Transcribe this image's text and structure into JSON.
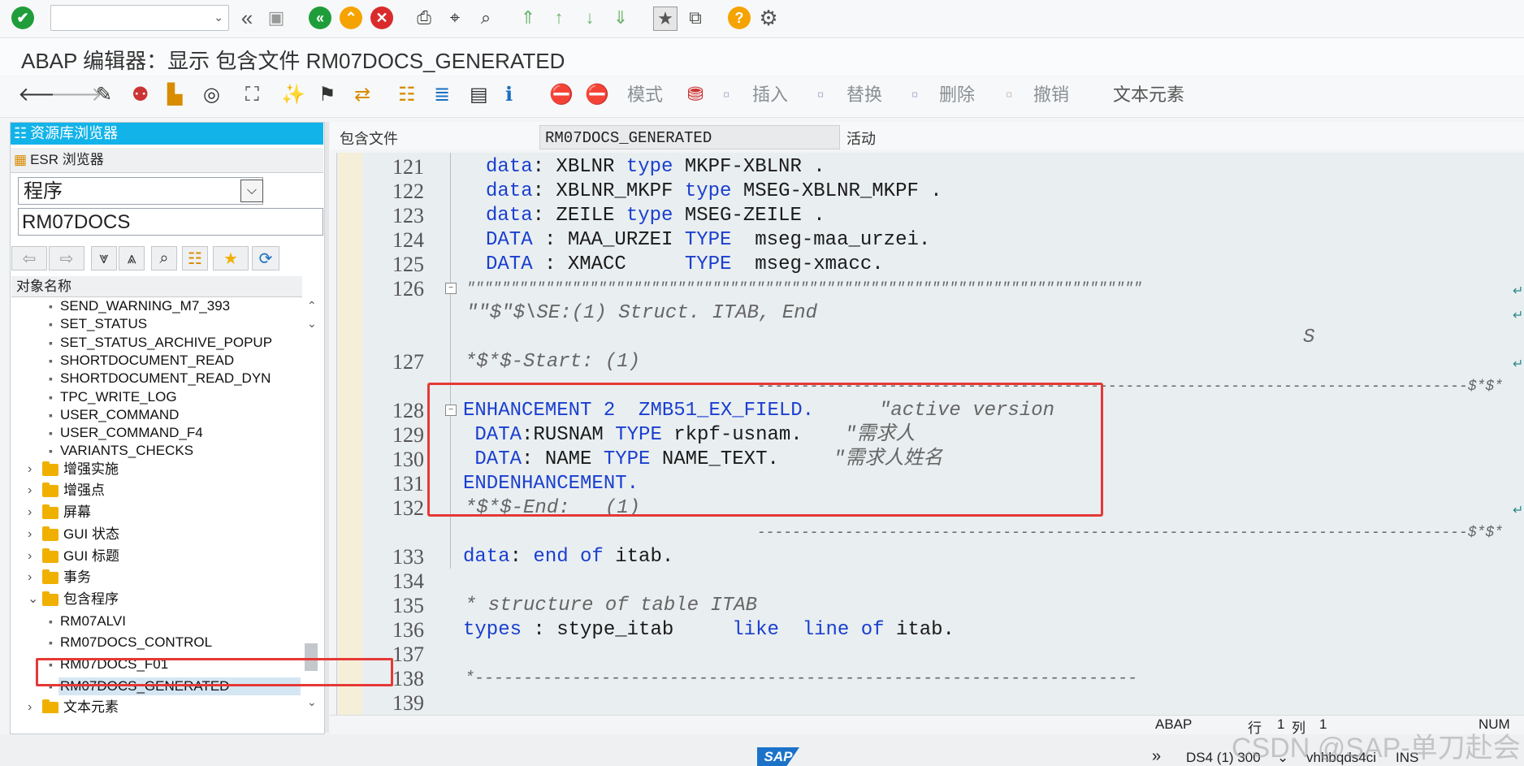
{
  "window": {
    "title": "ABAP 编辑器：显示 包含文件 RM07DOCS_GENERATED"
  },
  "app_toolbar": {
    "mode_label": "模式",
    "insert_label": "插入",
    "replace_label": "替换",
    "delete_label": "删除",
    "undo_label": "撤销",
    "text_elements_label": "文本元素"
  },
  "left_panel": {
    "repo_browser_label": "资源库浏览器",
    "esr_browser_label": "ESR 浏览器",
    "object_type": "程序",
    "object_name": "RM07DOCS",
    "tree_header": "对象名称",
    "tree": [
      {
        "label": "SEND_WARNING_M7_393",
        "kind": "leaf"
      },
      {
        "label": "SET_STATUS",
        "kind": "leaf"
      },
      {
        "label": "SET_STATUS_ARCHIVE_POPUP",
        "kind": "leaf"
      },
      {
        "label": "SHORTDOCUMENT_READ",
        "kind": "leaf"
      },
      {
        "label": "SHORTDOCUMENT_READ_DYN",
        "kind": "leaf"
      },
      {
        "label": "TPC_WRITE_LOG",
        "kind": "leaf"
      },
      {
        "label": "USER_COMMAND",
        "kind": "leaf"
      },
      {
        "label": "USER_COMMAND_F4",
        "kind": "leaf"
      },
      {
        "label": "VARIANTS_CHECKS",
        "kind": "leaf"
      },
      {
        "label": "增强实施",
        "kind": "folder"
      },
      {
        "label": "增强点",
        "kind": "folder"
      },
      {
        "label": "屏幕",
        "kind": "folder"
      },
      {
        "label": "GUI 状态",
        "kind": "folder"
      },
      {
        "label": "GUI 标题",
        "kind": "folder"
      },
      {
        "label": "事务",
        "kind": "folder"
      },
      {
        "label": "包含程序",
        "kind": "folder-open"
      },
      {
        "label": "RM07ALVI",
        "kind": "leaf"
      },
      {
        "label": "RM07DOCS_CONTROL",
        "kind": "leaf"
      },
      {
        "label": "RM07DOCS_F01",
        "kind": "leaf"
      },
      {
        "label": "RM07DOCS_GENERATED",
        "kind": "leaf-selected"
      },
      {
        "label": "文本元素",
        "kind": "folder"
      }
    ]
  },
  "editor": {
    "include_label": "包含文件",
    "include_name": "RM07DOCS_GENERATED",
    "status": "活动",
    "line_numbers": [
      "121",
      "122",
      "123",
      "124",
      "125",
      "126",
      "127",
      "128",
      "129",
      "130",
      "131",
      "132",
      "133",
      "134",
      "135",
      "136",
      "137",
      "138",
      "139"
    ],
    "code": {
      "l121": "data: XBLNR type MKPF-XBLNR .",
      "l122": "data: XBLNR_MKPF type MSEG-XBLNR_MKPF .",
      "l123": "data: ZEILE type MSEG-ZEILE .",
      "l124": "DATA : MAA_URZEI TYPE  mseg-maa_urzei.",
      "l125": "DATA : XMACC     TYPE  mseg-xmacc.",
      "l126": "\"\"\"\"\"\"\"\"\"\"\"\"\"\"\"\"\"\"\"\"\"\"\"\"\"\"\"\"\"\"\"\"\"\"\"\"\"\"\"\"\"\"\"\"\"\"\"\"\"\"\"\"\"\"\"\"\"\"\"\"\"\"\"\"\"\"\"\"\"\"\"\"\"\"\"\"\"",
      "l126b": "\"\"$\"$\\SE:(1) Struct. ITAB, End",
      "l126c": "S",
      "l127": "*$*$-Start: (1)",
      "l127b": "---------------------------------------------------------------------------------$*$*",
      "l128a": "ENHANCEMENT 2  ZMB51_EX_FIELD.",
      "l128b": "\"active version",
      "l129a": " DATA:RUSNAM TYPE rkpf-usnam.",
      "l129b": "\"需求人",
      "l130a": " DATA: NAME TYPE NAME_TEXT.",
      "l130b": "\"需求人姓名",
      "l131": "ENDENHANCEMENT.",
      "l132": "*$*$-End:   (1)",
      "l132b": "---------------------------------------------------------------------------------$*$*",
      "l133": "data: end of itab.",
      "l135": "* structure of table ITAB",
      "l136": "types : stype_itab     like  line of itab.",
      "l138": "*--------------------------------------------------------------------"
    }
  },
  "statusbar": {
    "lang": "ABAP",
    "row_label": "行",
    "row_value": "1",
    "col_label": "列",
    "col_value": "1",
    "num": "NUM",
    "system": "DS4 (1) 300",
    "host": "vhhbqds4ci",
    "ins": "INS",
    "sap_logo": "SAP"
  },
  "watermark": "CSDN @SAP-单刀赴会",
  "colors": {
    "accent": "#12b3e9",
    "highlight_box": "#e53935",
    "keyword": "#1a3fcf",
    "editor_bg": "#e9eef0"
  }
}
